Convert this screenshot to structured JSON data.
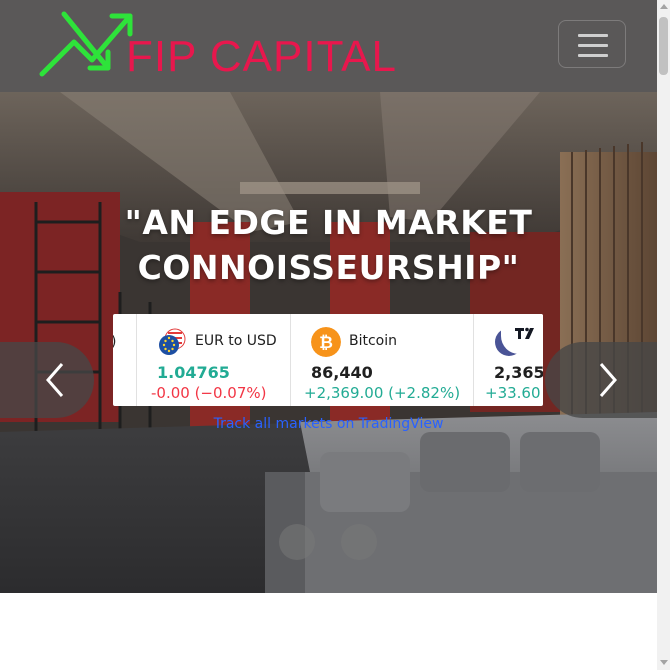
{
  "brand": {
    "name": "FIP CAPITAL",
    "logo_icon": "trend-arrows-icon",
    "accent": "#e8174d",
    "arrow_color": "#2ee33a"
  },
  "nav": {
    "menu_icon": "hamburger-icon"
  },
  "hero": {
    "headline_line1": "\"AN EDGE IN MARKET",
    "headline_line2": "CONNOISSEURSHIP\"",
    "prev_icon": "chevron-left-icon",
    "next_icon": "chevron-right-icon",
    "slide_count": 2
  },
  "ticker": {
    "items": [
      {
        "name": "EUR to USD",
        "price": "1.04765",
        "change": "-0.00 (−0.07%)",
        "price_color": "#22ab94",
        "change_color": "#f23645",
        "icon": "eu-us-flag-icon"
      },
      {
        "name": "Bitcoin",
        "price": "86,440",
        "change": "+2,369.00 (+2.82%)",
        "price_color": "#202020",
        "change_color": "#22ab94",
        "icon": "bitcoin-icon"
      },
      {
        "name": "",
        "price": "2,365",
        "change": "+33.60",
        "price_color": "#202020",
        "change_color": "#22ab94",
        "icon": "moon-icon"
      }
    ],
    "badge_icon": "tradingview-logo-icon",
    "link_text": "Track all markets on TradingView",
    "link_color": "#2962ff"
  }
}
